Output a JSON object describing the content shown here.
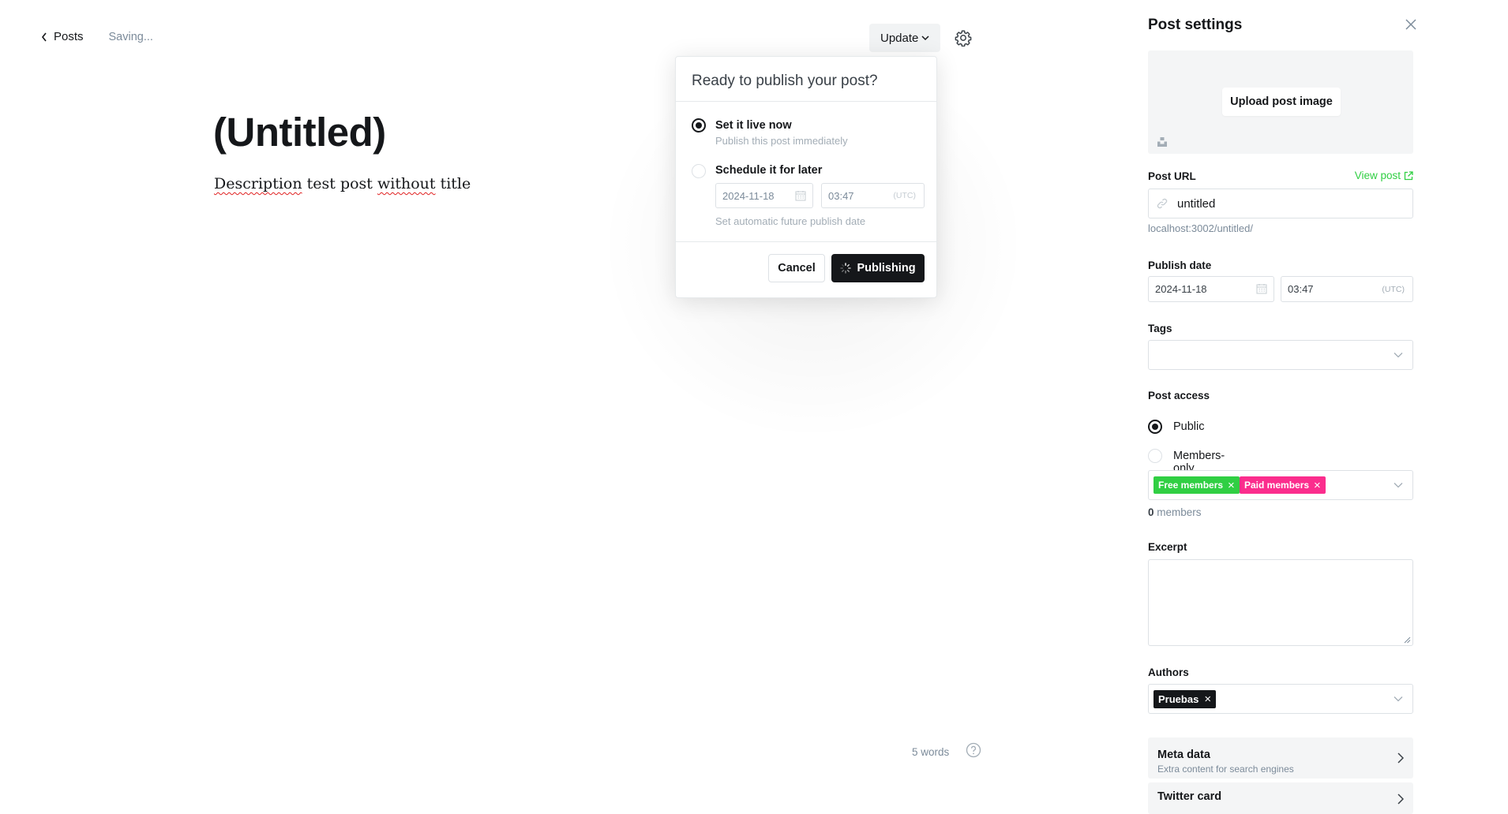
{
  "topbar": {
    "back_label": "Posts",
    "status": "Saving...",
    "update_label": "Update"
  },
  "editor": {
    "title": "(Untitled)",
    "body_words": [
      "Description",
      "test post",
      "without",
      "title"
    ],
    "word_count": "5 words"
  },
  "publish_menu": {
    "heading": "Ready to publish your post?",
    "option_now_label": "Set it live now",
    "option_now_sub": "Publish this post immediately",
    "option_later_label": "Schedule it for later",
    "schedule_date": "2024-11-18",
    "schedule_time": "03:47",
    "timezone": "(UTC)",
    "schedule_hint": "Set automatic future publish date",
    "cancel_label": "Cancel",
    "publishing_label": "Publishing",
    "selected_option": "now"
  },
  "settings": {
    "title": "Post settings",
    "upload_label": "Upload post image",
    "url_label": "Post URL",
    "view_post_label": "View post",
    "url_value": "untitled",
    "url_hint": "localhost:3002/untitled/",
    "publish_date_label": "Publish date",
    "publish_date": "2024-11-18",
    "publish_time": "03:47",
    "timezone": "(UTC)",
    "tags_label": "Tags",
    "access_label": "Post access",
    "access_public": "Public",
    "access_members": "Members-only",
    "access_selected": "public",
    "segments": [
      {
        "label": "Free members",
        "color": "#30cf43"
      },
      {
        "label": "Paid members",
        "color": "#fb2d8d"
      }
    ],
    "members_count": "0",
    "members_suffix": "members",
    "excerpt_label": "Excerpt",
    "authors_label": "Authors",
    "author": "Pruebas",
    "meta_title": "Meta data",
    "meta_sub": "Extra content for search engines",
    "twitter_title": "Twitter card"
  },
  "colors": {
    "accent_green": "#30cf43",
    "accent_pink": "#fb2d8d",
    "dark": "#15171a"
  }
}
